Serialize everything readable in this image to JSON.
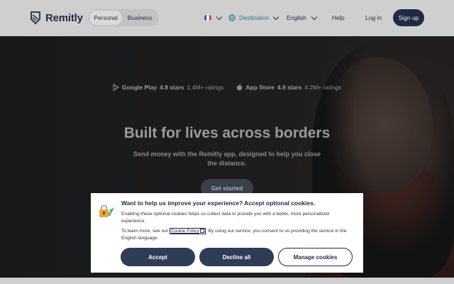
{
  "header": {
    "brand": "Remitly",
    "segments": [
      {
        "label": "Personal",
        "active": true
      },
      {
        "label": "Business",
        "active": false
      }
    ],
    "country_flag": "france-flag",
    "destination_label": "Destination",
    "language_label": "English",
    "help_label": "Help",
    "login_label": "Log in",
    "signup_label": "Sign up"
  },
  "hero": {
    "ratings": [
      {
        "icon": "google-play-icon",
        "store": "Google Play",
        "stars": "4.8 stars",
        "count": "1.4M+ ratings"
      },
      {
        "icon": "apple-icon",
        "store": "App Store",
        "stars": "4.9 stars",
        "count": "4.2M+ ratings"
      }
    ],
    "headline": "Built for lives across borders",
    "subheadline": "Send money with the Remitly app, designed to help you close the distance.",
    "cta_label": "Get started"
  },
  "cookie_banner": {
    "title": "Want to help us improve your experience? Accept optional cookies.",
    "paragraph1": "Enabling these optional cookies helps us collect data to provide you with a better, more personalized experience.",
    "paragraph2_prefix": "To learn more, see our",
    "policy_link": "Cookie Policy",
    "paragraph2_suffix": ". By using our service, you consent to us providing the service in the English language.",
    "buttons": {
      "accept": "Accept",
      "decline": "Decline all",
      "manage": "Manage cookies"
    }
  },
  "colors": {
    "brand_navy": "#1f2a44",
    "accent_teal": "#2b7a8c",
    "button_dark": "#2f3c56"
  }
}
